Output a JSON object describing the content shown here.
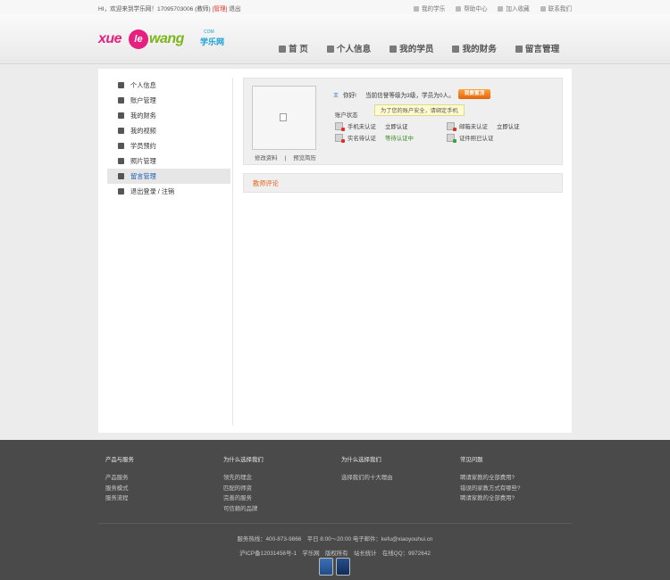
{
  "topbar": {
    "welcome": "HI，欢迎来到学乐网！",
    "user_id": "17095703006",
    "role": "(教师)",
    "admin": "[管理]",
    "logout": "退出",
    "links": [
      {
        "label": "我的学乐",
        "icon": "heart-icon"
      },
      {
        "label": "帮助中心",
        "icon": "help-icon"
      },
      {
        "label": "加入收藏",
        "icon": "bookmark-icon"
      },
      {
        "label": "联系我们",
        "icon": "mail-icon"
      }
    ]
  },
  "logo": {
    "part1": "xue",
    "part2": "le",
    "part3": "wang",
    "cn": "学乐网",
    "com": "COM"
  },
  "nav": [
    {
      "label": "首 页",
      "icon": "home-icon"
    },
    {
      "label": "个人信息",
      "icon": "user-icon"
    },
    {
      "label": "我的学员",
      "icon": "users-icon"
    },
    {
      "label": "我的财务",
      "icon": "edit-icon"
    },
    {
      "label": "留言管理",
      "icon": "mail-icon"
    }
  ],
  "sidebar": {
    "items": [
      {
        "label": "个人信息",
        "icon": "user-icon"
      },
      {
        "label": "账户管理",
        "icon": "account-icon"
      },
      {
        "label": "我的财务",
        "icon": "pencil-icon"
      },
      {
        "label": "我的视频",
        "icon": "video-icon"
      },
      {
        "label": "学员预约",
        "icon": "users-icon"
      },
      {
        "label": "照片管理",
        "icon": "photo-icon"
      },
      {
        "label": "留言管理",
        "icon": "mail-icon"
      },
      {
        "label": "退出登录 / 注销",
        "icon": "logout-icon"
      }
    ],
    "active_index": 6
  },
  "profile": {
    "edit_link": "修改资料",
    "separator": "|",
    "preview_link": "预览简历",
    "user_icon_text": "王",
    "greeting": "你好!",
    "level_msg": "当前信誉等级为3级，学员为0人。",
    "upgrade_button": "我要置顶",
    "status_label": "账户状态",
    "tooltip": "为了您的账户安全，请绑定手机",
    "statuses": [
      {
        "label": "手机未认证",
        "action": "立即认证",
        "icon": "phone-icon",
        "state": "warn"
      },
      {
        "label": "邮箱未认证",
        "action": "立即认证",
        "icon": "email-icon",
        "state": "warn"
      },
      {
        "label": "实名待认证",
        "action": "等待认证中",
        "icon": "id-card-icon",
        "state": "warn"
      },
      {
        "label": "证件照已认证",
        "action": "",
        "icon": "certificate-icon",
        "state": "ok"
      }
    ]
  },
  "reviews": {
    "title": "教师评论"
  },
  "footer": {
    "columns": [
      {
        "heading": "产品与服务",
        "links": [
          "产品服务",
          "服务模式",
          "服务流程"
        ]
      },
      {
        "heading": "为什么选择我们",
        "links": [
          "领先的理念",
          "匹配的师资",
          "完善的服务",
          "可信赖的品牌"
        ]
      },
      {
        "heading": "为什么选择我们",
        "links": [
          "选择我们的十大理由"
        ]
      },
      {
        "heading": "常见问题",
        "links": [
          "聘请家教的全部费用?",
          "错误的家教方式有哪些?",
          "聘请家教的全部费用?"
        ]
      }
    ],
    "hotline": "服务热线：400-873-9866　平日 8:00～20:00 电子邮件：kefu@xiaoyouhui.cn",
    "icp": "沪ICP备12031456号-1　学乐网　版权所有　站长统计　在线QQ：9972642",
    "badges": [
      "school-badge-icon",
      "police-badge-icon"
    ]
  }
}
